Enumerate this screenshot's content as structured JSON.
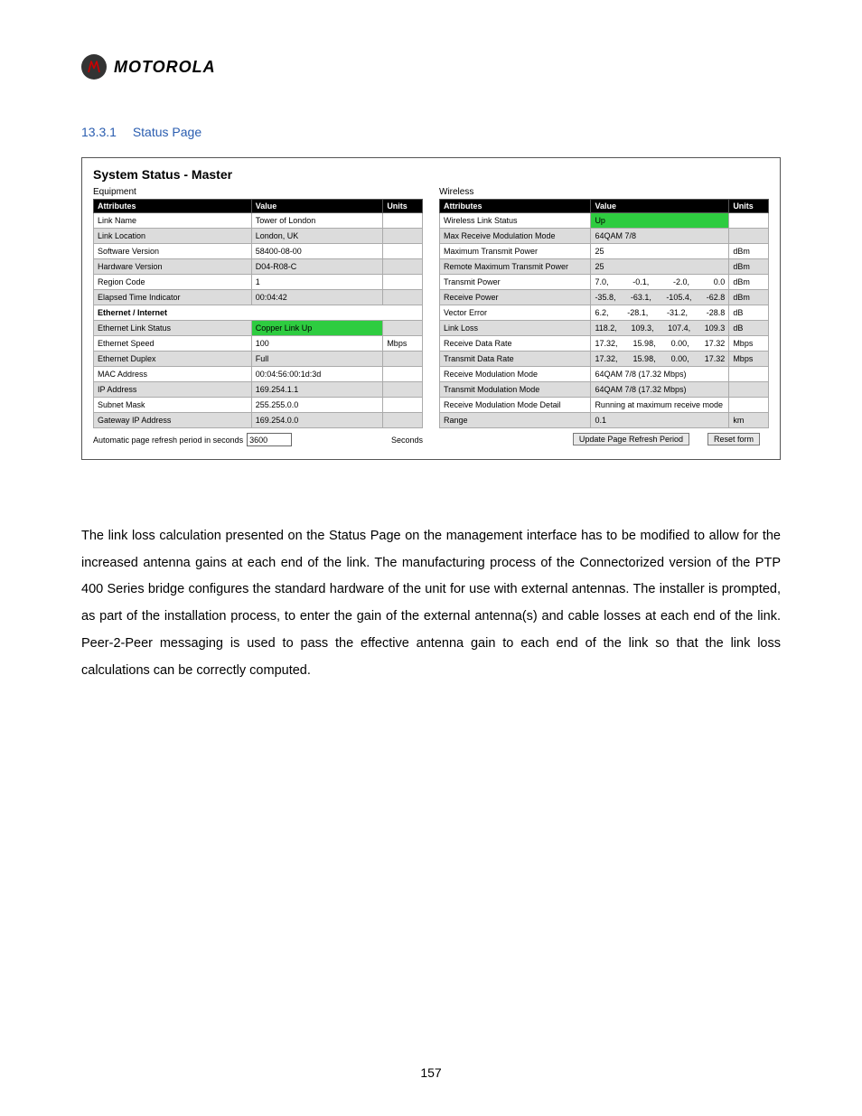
{
  "brand": "MOTOROLA",
  "heading_num": "13.3.1",
  "heading_title": "Status Page",
  "status_title": "System Status - Master",
  "equipment_label": "Equipment",
  "wireless_label": "Wireless",
  "th": {
    "attr": "Attributes",
    "val": "Value",
    "units": "Units"
  },
  "sub": {
    "eth": "Ethernet / Internet"
  },
  "eq": {
    "link_name": {
      "a": "Link Name",
      "v": "Tower of London",
      "u": ""
    },
    "link_location": {
      "a": "Link Location",
      "v": "London, UK",
      "u": ""
    },
    "software_version": {
      "a": "Software Version",
      "v": "58400-08-00",
      "u": ""
    },
    "hardware_version": {
      "a": "Hardware Version",
      "v": "D04-R08-C",
      "u": ""
    },
    "region_code": {
      "a": "Region Code",
      "v": "1",
      "u": ""
    },
    "elapsed_time": {
      "a": "Elapsed Time Indicator",
      "v": "00:04:42",
      "u": ""
    },
    "eth_status": {
      "a": "Ethernet Link Status",
      "v": "Copper Link Up",
      "u": ""
    },
    "eth_speed": {
      "a": "Ethernet Speed",
      "v": "100",
      "u": "Mbps"
    },
    "eth_duplex": {
      "a": "Ethernet Duplex",
      "v": "Full",
      "u": ""
    },
    "mac": {
      "a": "MAC Address",
      "v": "00:04:56:00:1d:3d",
      "u": ""
    },
    "ip": {
      "a": "IP Address",
      "v": "169.254.1.1",
      "u": ""
    },
    "subnet": {
      "a": "Subnet Mask",
      "v": "255.255.0.0",
      "u": ""
    },
    "gateway": {
      "a": "Gateway IP Address",
      "v": "169.254.0.0",
      "u": ""
    }
  },
  "wi": {
    "status": {
      "a": "Wireless Link Status",
      "v": "Up",
      "u": ""
    },
    "max_rx_mod": {
      "a": "Max Receive Modulation Mode",
      "v": "64QAM 7/8",
      "u": ""
    },
    "max_tx_pwr": {
      "a": "Maximum Transmit Power",
      "v": "25",
      "u": "dBm"
    },
    "remote_max_tx_pwr": {
      "a": "Remote Maximum Transmit Power",
      "v": "25",
      "u": "dBm"
    },
    "tx_power": {
      "a": "Transmit Power",
      "v1": "7.0,",
      "v2": "-0.1,",
      "v3": "-2.0,",
      "v4": "0.0",
      "u": "dBm"
    },
    "rx_power": {
      "a": "Receive Power",
      "v1": "-35.8,",
      "v2": "-63.1,",
      "v3": "-105.4,",
      "v4": "-62.8",
      "u": "dBm"
    },
    "vec_err": {
      "a": "Vector Error",
      "v1": "6.2,",
      "v2": "-28.1,",
      "v3": "-31.2,",
      "v4": "-28.8",
      "u": "dB"
    },
    "link_loss": {
      "a": "Link Loss",
      "v1": "118.2,",
      "v2": "109.3,",
      "v3": "107.4,",
      "v4": "109.3",
      "u": "dB"
    },
    "rx_rate": {
      "a": "Receive Data Rate",
      "v1": "17.32,",
      "v2": "15.98,",
      "v3": "0.00,",
      "v4": "17.32",
      "u": "Mbps"
    },
    "tx_rate": {
      "a": "Transmit Data Rate",
      "v1": "17.32,",
      "v2": "15.98,",
      "v3": "0.00,",
      "v4": "17.32",
      "u": "Mbps"
    },
    "rx_mod": {
      "a": "Receive Modulation Mode",
      "v": "64QAM 7/8 (17.32 Mbps)",
      "u": ""
    },
    "tx_mod": {
      "a": "Transmit Modulation Mode",
      "v": "64QAM 7/8 (17.32 Mbps)",
      "u": ""
    },
    "rx_mod_det": {
      "a": "Receive Modulation Mode Detail",
      "v": "Running at maximum receive mode",
      "u": ""
    },
    "range": {
      "a": "Range",
      "v": "0.1",
      "u": "km"
    }
  },
  "refresh": {
    "label": "Automatic page refresh period in seconds",
    "value": "3600",
    "ulabel": "Seconds",
    "update_btn": "Update Page Refresh Period",
    "reset_btn": "Reset form"
  },
  "body_text": "The link loss calculation presented on the Status Page on the management interface has to be modified to allow for the increased antenna gains at each end of the link. The manufacturing process of the Connectorized version of the PTP 400 Series bridge configures the standard hardware of the unit for use with external antennas. The installer is prompted, as part of the installation process, to enter the gain of the external antenna(s) and cable losses at each end of the link. Peer-2-Peer messaging is used to pass the effective antenna gain to each end of the link so that the link loss calculations can be correctly computed.",
  "page_number": "157"
}
